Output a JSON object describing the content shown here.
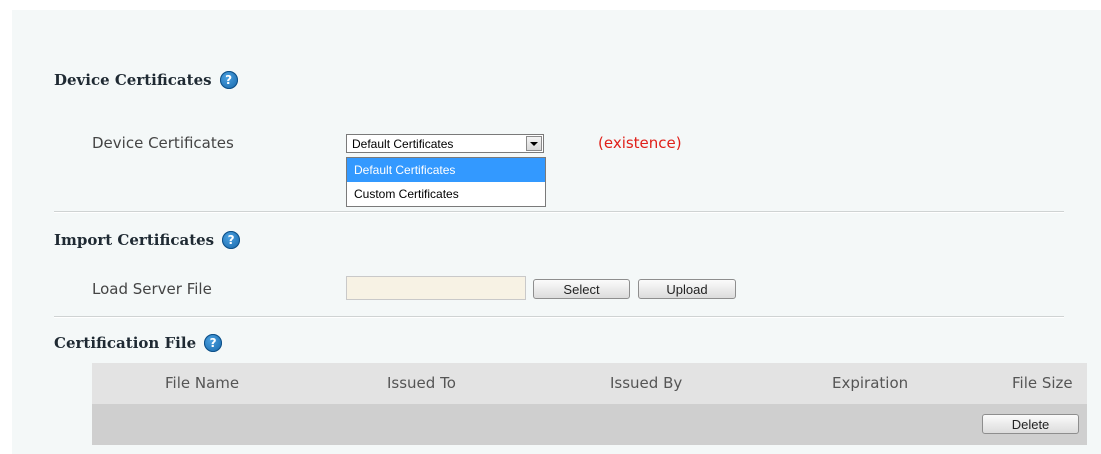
{
  "sections": {
    "device_certificates": {
      "title": "Device Certificates",
      "row_label": "Device Certificates",
      "select_value": "Default Certificates",
      "options": [
        "Default Certificates",
        "Custom Certificates"
      ],
      "status": "(existence)"
    },
    "import_certificates": {
      "title": "Import Certificates",
      "row_label": "Load Server File",
      "file_value": "",
      "select_button": "Select",
      "upload_button": "Upload"
    },
    "certification_file": {
      "title": "Certification File",
      "columns": [
        "File Name",
        "Issued To",
        "Issued By",
        "Expiration",
        "File Size"
      ],
      "delete_button": "Delete"
    }
  },
  "icons": {
    "help": "help-icon"
  },
  "colors": {
    "status_red": "#e0201a",
    "selected_option": "#3399ff",
    "help_icon": "#1565a8",
    "file_input_bg": "#f7f2e4"
  }
}
